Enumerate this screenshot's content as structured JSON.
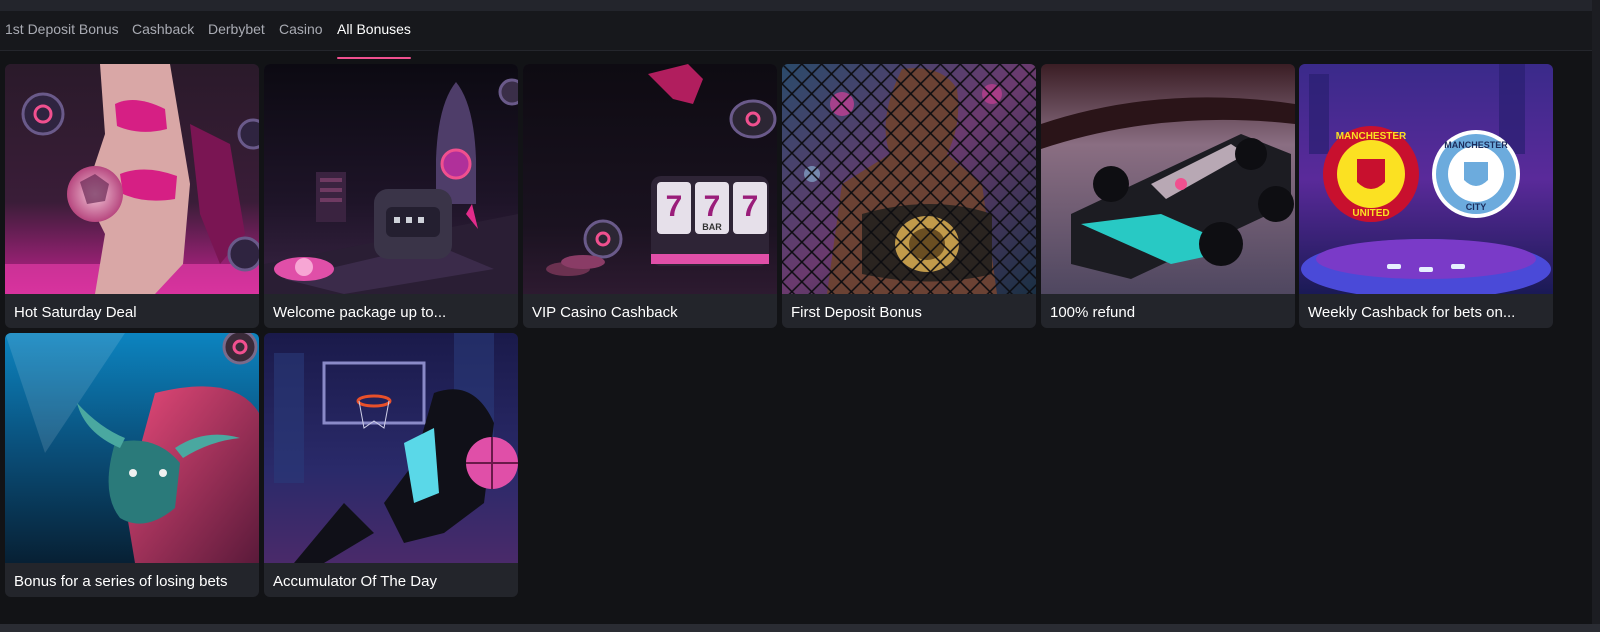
{
  "tabs": [
    {
      "label": "1st Deposit Bonus"
    },
    {
      "label": "Cashback"
    },
    {
      "label": "Derbybet"
    },
    {
      "label": "Casino"
    },
    {
      "label": "All Bonuses",
      "active": true
    }
  ],
  "colors": {
    "accent": "#f0508f",
    "background": "#121316",
    "card": "#23252b"
  },
  "cards": [
    {
      "title": "Hot Saturday Deal",
      "image": "dancer-with-football-image"
    },
    {
      "title": "Welcome package up to...",
      "image": "rocket-launch-image"
    },
    {
      "title": "VIP Casino Cashback",
      "image": "slot-machine-image",
      "slot_symbols": [
        "7",
        "7",
        "7"
      ],
      "slot_bar": "BAR"
    },
    {
      "title": "First Deposit Bonus",
      "image": "fighter-with-belt-image"
    },
    {
      "title": "100% refund",
      "image": "race-car-image"
    },
    {
      "title": "Weekly Cashback for bets on...",
      "image": "derby-crests-image",
      "crest_left": [
        "MANCHESTER",
        "UNITED"
      ],
      "crest_right": [
        "MANCHESTER",
        "CITY"
      ]
    },
    {
      "title": "Bonus for a series of losing bets",
      "image": "bull-image"
    },
    {
      "title": "Accumulator Of The Day",
      "image": "basketball-player-image"
    }
  ]
}
